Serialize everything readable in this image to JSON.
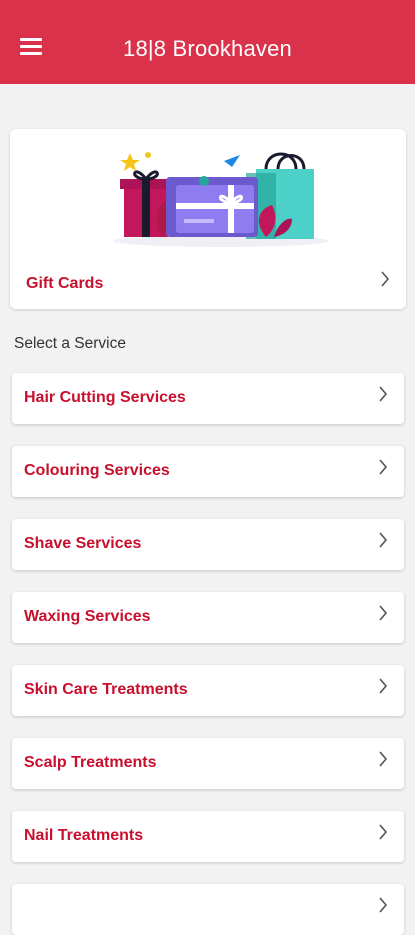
{
  "header": {
    "title": "18|8 Brookhaven",
    "menu_icon": "hamburger-menu-icon",
    "background_color": "#d9324a"
  },
  "gift_card": {
    "label": "Gift Cards",
    "illustration": "gift-card-illustration"
  },
  "section": {
    "label": "Select a Service"
  },
  "services": [
    {
      "label": "Hair Cutting Services"
    },
    {
      "label": "Colouring Services"
    },
    {
      "label": "Shave Services"
    },
    {
      "label": "Waxing Services"
    },
    {
      "label": "Skin Care Treatments"
    },
    {
      "label": "Scalp Treatments"
    },
    {
      "label": "Nail Treatments"
    }
  ],
  "colors": {
    "accent": "#c8102e",
    "background": "#f2f2f2"
  }
}
